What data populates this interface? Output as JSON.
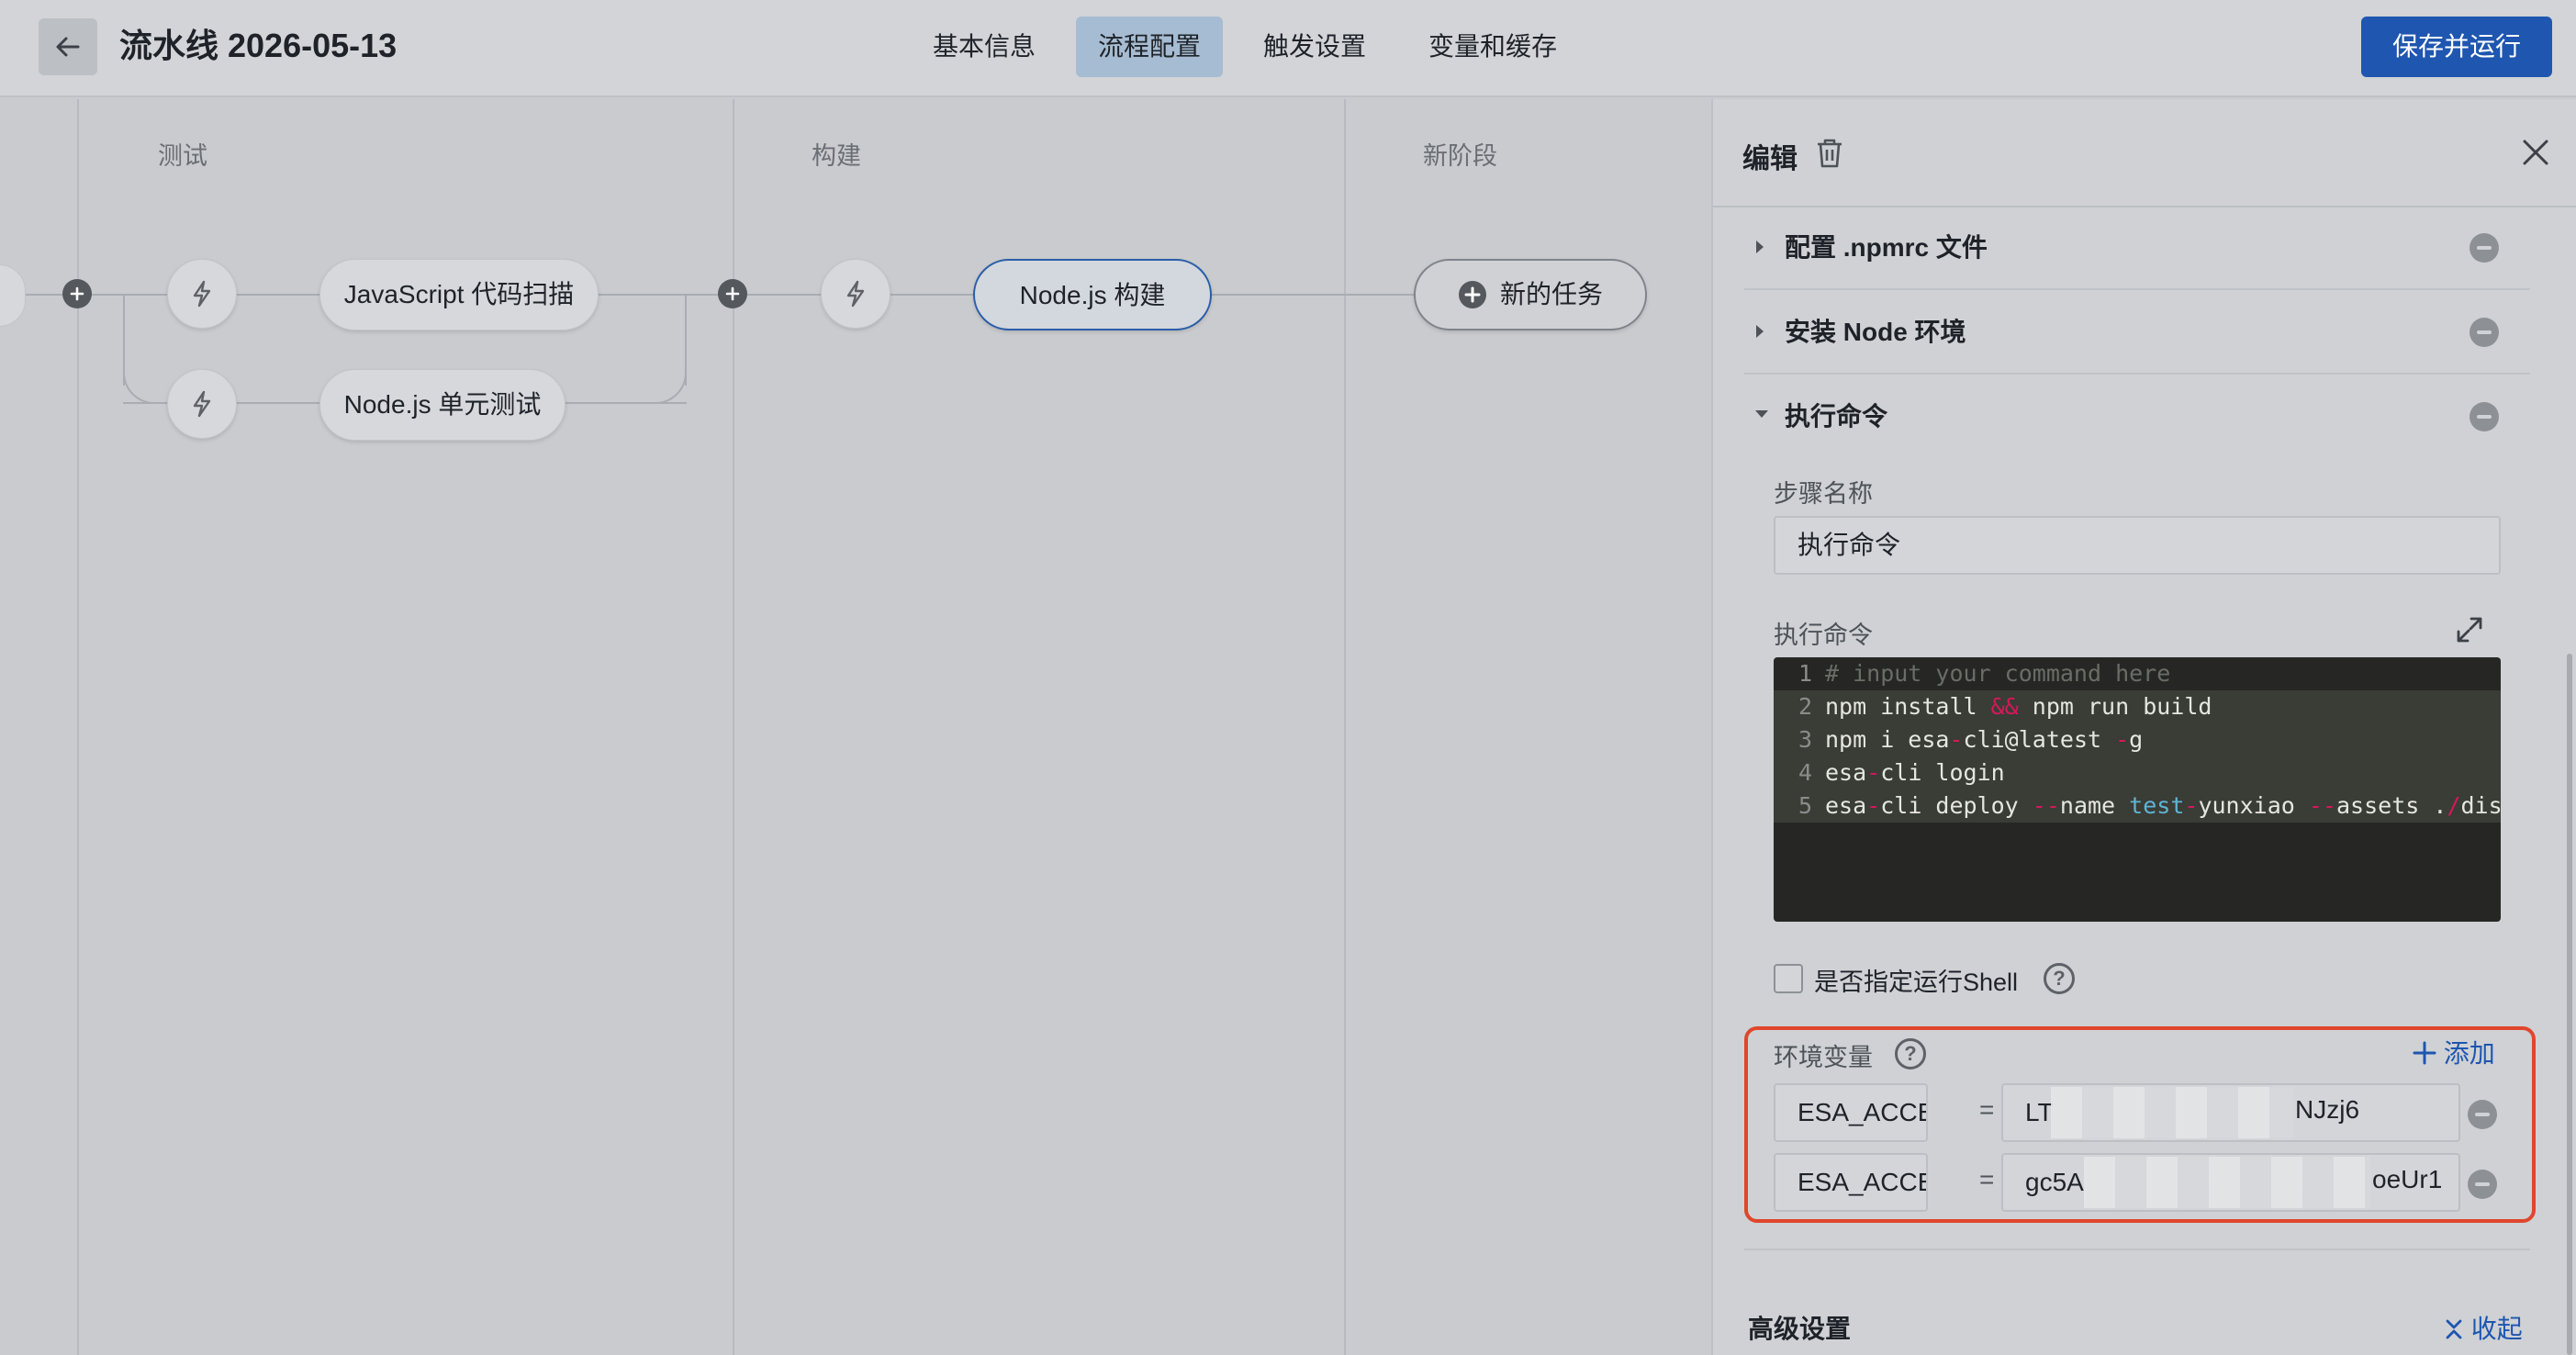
{
  "header": {
    "title": "流水线 2026-05-13",
    "tabs": [
      {
        "label": "基本信息",
        "active": false
      },
      {
        "label": "流程配置",
        "active": true
      },
      {
        "label": "触发设置",
        "active": false
      },
      {
        "label": "变量和缓存",
        "active": false
      }
    ],
    "save_run_label": "保存并运行"
  },
  "canvas": {
    "stages": [
      {
        "title": "测试",
        "jobs": [
          "JavaScript 代码扫描",
          "Node.js 单元测试"
        ]
      },
      {
        "title": "构建",
        "jobs": [
          "Node.js 构建"
        ]
      },
      {
        "title": "新阶段",
        "jobs": [
          "新的任务"
        ]
      }
    ]
  },
  "panel": {
    "title": "编辑",
    "sections": [
      {
        "label": "配置 .npmrc 文件",
        "expanded": false
      },
      {
        "label": "安装 Node 环境",
        "expanded": false
      },
      {
        "label": "执行命令",
        "expanded": true
      }
    ],
    "step_name_label": "步骤名称",
    "step_name_value": "执行命令",
    "command_label": "执行命令",
    "code_lines": [
      {
        "n": "1",
        "text": "# input your command here"
      },
      {
        "n": "2",
        "text": "npm install && npm run build"
      },
      {
        "n": "3",
        "text": "npm i esa-cli@latest -g"
      },
      {
        "n": "4",
        "text": "esa-cli login"
      },
      {
        "n": "5",
        "text": "esa-cli deploy --name test-yunxiao --assets ./dist"
      }
    ],
    "shell_checkbox_label": "是否指定运行Shell",
    "env": {
      "label": "环境变量",
      "add_label": "添加",
      "rows": [
        {
          "key": "ESA_ACCESS",
          "eq": "=",
          "value_start": "LT",
          "value_end": "NJzj6"
        },
        {
          "key": "ESA_ACCESS",
          "eq": "=",
          "value_start": "gc5A",
          "value_end": "oeUr1"
        }
      ]
    },
    "advanced_label": "高级设置",
    "collapse_label": "收起"
  },
  "colors": {
    "primary": "#1e56b0",
    "highlight_border": "#e0462c"
  }
}
